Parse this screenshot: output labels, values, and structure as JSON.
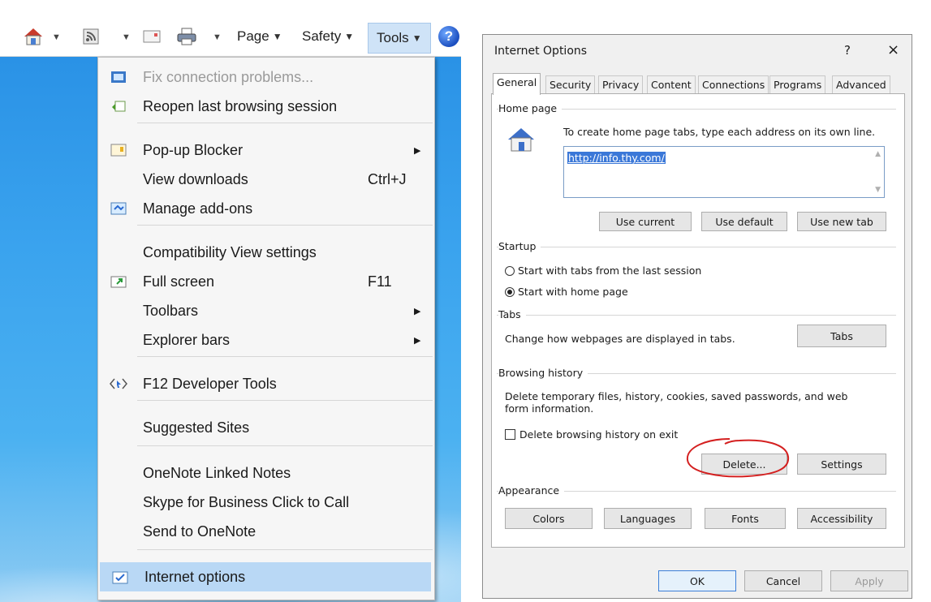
{
  "command_bar": {
    "page_label": "Page",
    "safety_label": "Safety",
    "tools_label": "Tools",
    "help_glyph": "?"
  },
  "tools_menu": {
    "items": [
      {
        "label": "Fix connection problems...",
        "icon": "connection-icon",
        "shortcut": "",
        "disabled": true
      },
      {
        "label": "Reopen last browsing session",
        "icon": "reopen-session-icon",
        "shortcut": ""
      },
      {
        "label": "Pop-up Blocker",
        "icon": "popup-blocker-icon",
        "shortcut": "",
        "submenu": true
      },
      {
        "label": "View downloads",
        "icon": "",
        "shortcut": "Ctrl+J"
      },
      {
        "label": "Manage add-ons",
        "icon": "addons-icon",
        "shortcut": ""
      },
      {
        "label": "Compatibility View settings",
        "icon": "",
        "shortcut": ""
      },
      {
        "label": "Full screen",
        "icon": "fullscreen-icon",
        "shortcut": "F11"
      },
      {
        "label": "Toolbars",
        "icon": "",
        "shortcut": "",
        "submenu": true
      },
      {
        "label": "Explorer bars",
        "icon": "",
        "shortcut": "",
        "submenu": true
      },
      {
        "label": "F12 Developer Tools",
        "icon": "developer-tools-icon",
        "shortcut": ""
      },
      {
        "label": "Suggested Sites",
        "icon": "",
        "shortcut": ""
      },
      {
        "label": "OneNote Linked Notes",
        "icon": "",
        "shortcut": ""
      },
      {
        "label": "Skype for Business Click to Call",
        "icon": "",
        "shortcut": ""
      },
      {
        "label": "Send to OneNote",
        "icon": "",
        "shortcut": ""
      },
      {
        "label": "Internet options",
        "icon": "internet-options-icon",
        "shortcut": "",
        "highlighted": true
      }
    ]
  },
  "dialog": {
    "title": "Internet Options",
    "help": "?",
    "close": "×",
    "tabs": [
      "General",
      "Security",
      "Privacy",
      "Content",
      "Connections",
      "Programs",
      "Advanced"
    ],
    "active_tab": "General",
    "home_page": {
      "group_label": "Home page",
      "instruction": "To create home page tabs, type each address on its own line.",
      "url": "http://info.thy.com/",
      "use_current": "Use current",
      "use_default": "Use default",
      "use_new_tab": "Use new tab"
    },
    "startup": {
      "group_label": "Startup",
      "option_last_session": "Start with tabs from the last session",
      "option_home_page": "Start with home page",
      "selected": "Start with home page"
    },
    "tabs_group": {
      "group_label": "Tabs",
      "description": "Change how webpages are displayed in tabs.",
      "button": "Tabs"
    },
    "browsing_history": {
      "group_label": "Browsing history",
      "description_line1": "Delete temporary files, history, cookies, saved passwords, and web",
      "description_line2": "form information.",
      "delete_on_exit": "Delete browsing history on exit",
      "delete_on_exit_checked": false,
      "delete_button": "Delete...",
      "settings_button": "Settings"
    },
    "appearance": {
      "group_label": "Appearance",
      "colors": "Colors",
      "languages": "Languages",
      "fonts": "Fonts",
      "accessibility": "Accessibility"
    },
    "footer": {
      "ok": "OK",
      "cancel": "Cancel",
      "apply": "Apply"
    }
  },
  "colors": {
    "sky_blue": "#3aa3ee",
    "menu_highlight": "#b9d8f5",
    "annotation_red": "#d42020"
  }
}
